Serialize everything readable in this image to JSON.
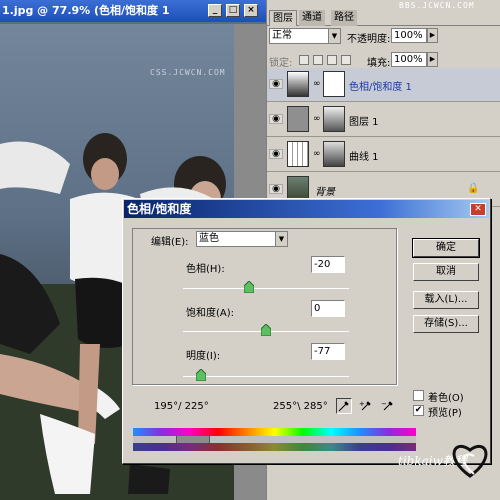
{
  "document_window": {
    "title": "1.jpg @ 77.9% (色相/饱和度 1",
    "watermark": "CSS.JCWCN.COM"
  },
  "layers_panel": {
    "tabs": [
      "图层",
      "通道",
      "路径"
    ],
    "watermark": "BBS.JCWCN.COM",
    "blend_mode": "正常",
    "opacity_label": "不透明度:",
    "opacity_value": "100%",
    "lock_label": "锁定:",
    "fill_label": "填充:",
    "fill_value": "100%",
    "layers": [
      {
        "name": "色相/饱和度 1",
        "selected": true
      },
      {
        "name": "图层 1",
        "selected": false
      },
      {
        "name": "曲线 1",
        "selected": false
      },
      {
        "name": "背景",
        "selected": false
      }
    ]
  },
  "hue_sat_dialog": {
    "title": "色相/饱和度",
    "edit_label": "编辑(E):",
    "edit_value": "蓝色",
    "hue_label": "色相(H):",
    "hue_value": "-20",
    "saturation_label": "饱和度(A):",
    "saturation_value": "0",
    "lightness_label": "明度(I):",
    "lightness_value": "-77",
    "range_left": "195°/ 225°",
    "range_right": "255°\\ 285°",
    "buttons": {
      "ok": "确定",
      "cancel": "取消",
      "load": "载入(L)...",
      "save": "存储(S)..."
    },
    "colorize_label": "着色(O)",
    "colorize_checked": false,
    "preview_label": "预览(P)",
    "preview_checked": true
  },
  "signature": "tibkaiw教程",
  "colors": {
    "titlebar": "#1d4fb8",
    "dialog_bg": "#d4d0c8",
    "slider_green": "#4caf50"
  }
}
